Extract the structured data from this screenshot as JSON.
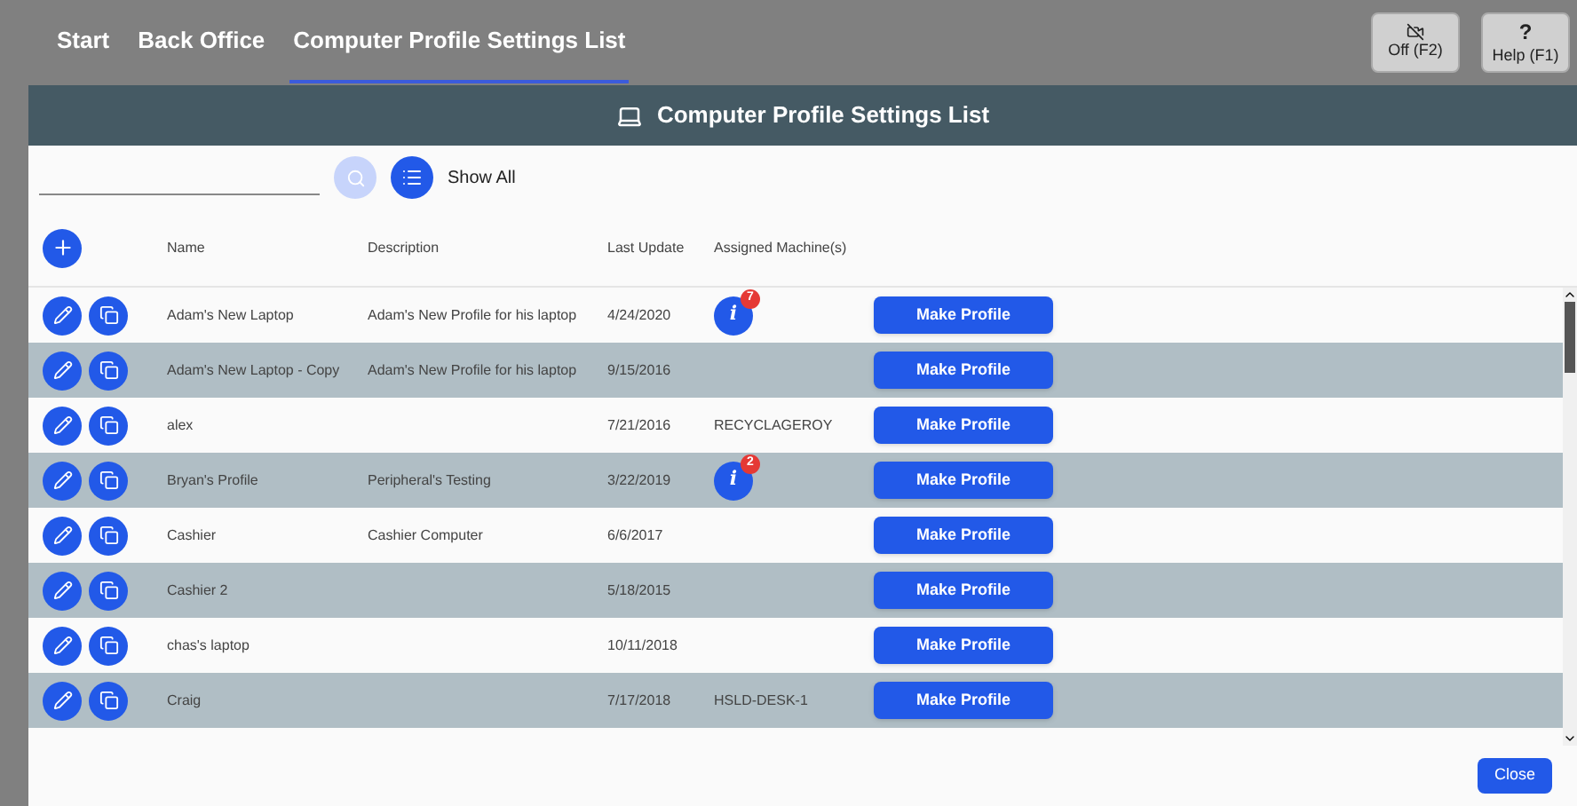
{
  "breadcrumbs": [
    {
      "label": "Start",
      "selected": false
    },
    {
      "label": "Back Office",
      "selected": false
    },
    {
      "label": "Computer Profile Settings List",
      "selected": true
    }
  ],
  "top_buttons": [
    {
      "kind": "off",
      "label": "Off (F2)"
    },
    {
      "kind": "help",
      "icon_text": "?",
      "label": "Help (F1)"
    }
  ],
  "panel": {
    "title": "Computer Profile Settings List"
  },
  "search": {
    "show_all": "Show All"
  },
  "table": {
    "columns": [
      "Name",
      "Description",
      "Last Update",
      "Assigned Machine(s)"
    ],
    "rows": [
      {
        "name": "Adam's New Laptop",
        "description": "Adam's New Profile for his laptop",
        "last_update": "4/24/2020",
        "machines": {
          "kind": "info",
          "icon_text": "i",
          "count": "7"
        },
        "action": "Make Profile"
      },
      {
        "name": "Adam's New Laptop - Copy",
        "description": "Adam's New Profile for his laptop",
        "last_update": "9/15/2016",
        "action": "Make Profile"
      },
      {
        "name": "alex",
        "last_update": "7/21/2016",
        "machines": {
          "kind": "text",
          "text": "RECYCLAGEROY"
        },
        "action": "Make Profile"
      },
      {
        "name": "Bryan's Profile",
        "description": "Peripheral's Testing",
        "last_update": "3/22/2019",
        "machines": {
          "kind": "info",
          "icon_text": "i",
          "count": "2"
        },
        "action": "Make Profile"
      },
      {
        "name": "Cashier",
        "description": "Cashier Computer",
        "last_update": "6/6/2017",
        "action": "Make Profile"
      },
      {
        "name": "Cashier 2",
        "last_update": "5/18/2015",
        "action": "Make Profile"
      },
      {
        "name": "chas's laptop",
        "last_update": "10/11/2018",
        "action": "Make Profile"
      },
      {
        "name": "Craig",
        "last_update": "7/17/2018",
        "machines": {
          "kind": "text",
          "text": "HSLD-DESK-1"
        },
        "action": "Make Profile"
      }
    ]
  },
  "footer": {
    "close": "Close"
  }
}
